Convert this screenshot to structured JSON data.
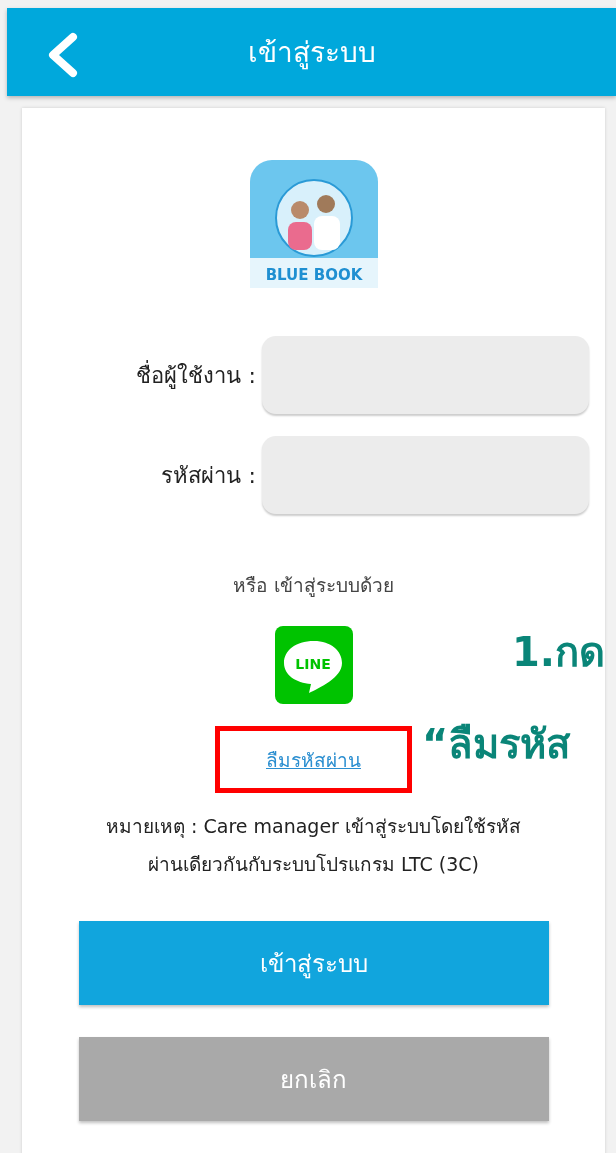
{
  "header": {
    "title": "เข้าสู่ระบบ"
  },
  "logo": {
    "caption": "BLUE BOOK"
  },
  "fields": [
    {
      "label": "ชื่อผู้ใช้งาน :"
    },
    {
      "label": "รหัสผ่าน :"
    }
  ],
  "alt_login": {
    "text": "หรือ เข้าสู่ระบบด้วย",
    "line_label": "LINE"
  },
  "forgot_link": {
    "text": "ลืมรหัสผ่าน",
    "highlighted": true
  },
  "note": [
    "หมายเหตุ : Care manager เข้าสู่ระบบโดยใช้รหัส",
    "ผ่านเดียวกันกับระบบโปรแกรม LTC (3C)"
  ],
  "buttons": [
    {
      "label": "เข้าสู่ระบบ",
      "kind": "primary"
    },
    {
      "label": "ยกเลิก",
      "kind": "secondary"
    }
  ],
  "annotation": [
    "1.กด",
    "“ลืมรหัส"
  ]
}
